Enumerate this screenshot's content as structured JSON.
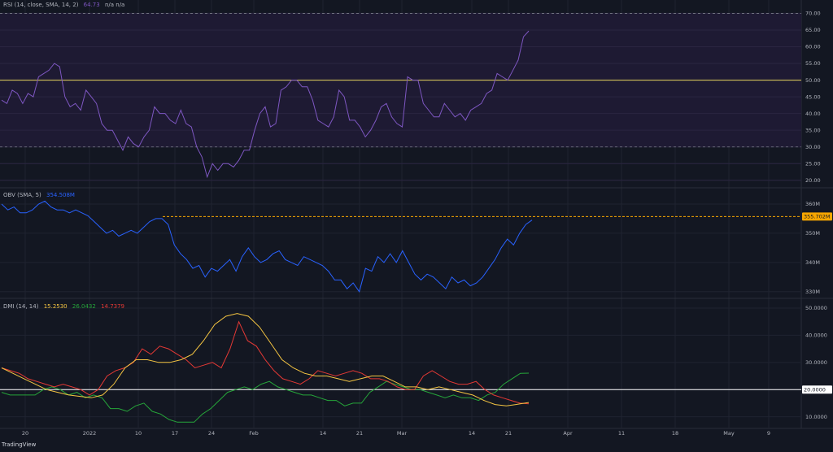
{
  "colors": {
    "background": "#131722",
    "grid": "#1f2330",
    "axis_text": "#b2b5be",
    "rsi_line": "#7e57c2",
    "rsi_band": "#1e1a33",
    "rsi_mid": "#e5d35b",
    "obv_line": "#2962ff",
    "obv_level": "#f7a600",
    "dmi_plus": "#26a63a",
    "dmi_minus": "#e53935",
    "dmi_adx": "#f5c542",
    "dmi_level": "#ffffff"
  },
  "panels": {
    "rsi": {
      "label": "RSI (14, close, SMA, 14, 2)",
      "value": "64.73",
      "extra": "n/a n/a"
    },
    "obv": {
      "label": "OBV (SMA, 5)",
      "value": "354.508M"
    },
    "dmi": {
      "label": "DMI (14, 14)",
      "adx_value": "15.2530",
      "plus_value": "26.0432",
      "minus_value": "14.7379"
    }
  },
  "brand": "TradingView",
  "chart_data": [
    {
      "type": "line",
      "title": "RSI (14, close, SMA, 14, 2)",
      "ylim": [
        18,
        74
      ],
      "yticks": [
        "70.00",
        "65.00",
        "60.00",
        "55.00",
        "50.00",
        "45.00",
        "40.00",
        "35.00",
        "30.00",
        "25.00",
        "20.00"
      ],
      "levels": [
        70,
        50,
        30
      ],
      "series": [
        {
          "values": [
            44,
            43,
            47,
            46,
            43,
            46,
            45,
            51,
            52,
            53,
            55,
            54,
            45,
            42,
            43,
            41,
            47,
            45,
            43,
            37,
            35,
            35,
            32,
            29,
            33,
            31,
            30,
            33,
            35,
            42,
            40,
            40,
            38,
            37,
            41,
            37,
            36,
            30,
            27,
            21,
            25,
            23,
            25,
            25,
            24,
            26,
            29,
            29,
            35,
            40,
            42,
            36,
            37,
            47,
            48,
            50,
            50,
            48,
            48,
            44,
            38,
            37,
            36,
            39,
            47,
            45,
            38,
            38,
            36,
            33,
            35,
            38,
            42,
            43,
            39,
            37,
            36,
            51,
            50,
            50,
            43,
            41,
            39,
            39,
            43,
            41,
            39,
            40,
            38,
            41,
            42,
            43,
            46,
            47,
            52,
            51,
            50,
            53,
            56,
            63,
            64.73
          ]
        }
      ]
    },
    {
      "type": "line",
      "title": "OBV (SMA, 5)",
      "ylim": [
        328,
        365
      ],
      "yticks": [
        "360M",
        "350M",
        "340M",
        "330M"
      ],
      "level": "355.702M",
      "series": [
        {
          "values": [
            360,
            358,
            359,
            357,
            357,
            358,
            360,
            361,
            359,
            358,
            358,
            357,
            358,
            357,
            356,
            354,
            352,
            350,
            351,
            349,
            350,
            351,
            350,
            352,
            354,
            355,
            355,
            353,
            346,
            343,
            341,
            338,
            339,
            335,
            338,
            337,
            339,
            341,
            337,
            342,
            345,
            342,
            340,
            341,
            343,
            344,
            341,
            340,
            339,
            342,
            341,
            340,
            339,
            337,
            334,
            334,
            331,
            333,
            330,
            338,
            337,
            342,
            340,
            343,
            340,
            344,
            340,
            336,
            334,
            336,
            335,
            333,
            331,
            335,
            333,
            334,
            332,
            333,
            335,
            338,
            341,
            345,
            348,
            346,
            350,
            353,
            354.508
          ]
        }
      ]
    },
    {
      "type": "line",
      "title": "DMI (14, 14)",
      "ylim": [
        6,
        53
      ],
      "yticks": [
        "50.0000",
        "40.0000",
        "30.0000",
        "20.0000",
        "10.0000"
      ],
      "level": "20.0000",
      "series": [
        {
          "color": "#26a63a",
          "values": [
            19,
            18,
            18,
            18,
            18,
            20,
            21,
            20,
            18,
            19,
            17,
            18,
            17,
            13,
            13,
            12,
            14,
            15,
            12,
            11,
            9,
            8,
            8,
            8,
            11,
            13,
            16,
            19,
            20,
            21,
            20,
            22,
            23,
            21,
            20,
            19,
            18,
            18,
            17,
            16,
            16,
            14,
            15,
            15,
            19,
            21,
            23,
            22,
            21,
            20,
            20,
            19,
            18,
            17,
            18,
            17,
            17,
            16,
            18,
            19,
            22,
            24,
            26,
            26.0432
          ]
        },
        {
          "color": "#e53935",
          "values": [
            28,
            27,
            26,
            24,
            23,
            22,
            21,
            22,
            21,
            20,
            18,
            20,
            25,
            27,
            28,
            30,
            35,
            33,
            36,
            35,
            33,
            31,
            28,
            29,
            30,
            28,
            35,
            45,
            38,
            36,
            31,
            27,
            24,
            23,
            22,
            24,
            27,
            26,
            25,
            26,
            27,
            26,
            24,
            24,
            23,
            21,
            20,
            20,
            25,
            27,
            25,
            23,
            22,
            22,
            23,
            20,
            18,
            17,
            16,
            15,
            14.7379
          ]
        },
        {
          "color": "#f5c542",
          "values": [
            28,
            26,
            24,
            22,
            20,
            19,
            18,
            17.5,
            17,
            18,
            22,
            28,
            31,
            31,
            30,
            30,
            31,
            33,
            38,
            44,
            47,
            48,
            47,
            43,
            37,
            31,
            28,
            26,
            25,
            25,
            24,
            23,
            24,
            25,
            25,
            23,
            21,
            21,
            20,
            21,
            20,
            19,
            18,
            16,
            14.5,
            14,
            14.6,
            15.253
          ]
        }
      ]
    }
  ],
  "time_axis": [
    "20",
    "2022",
    "10",
    "17",
    "24",
    "Feb",
    "14",
    "21",
    "Mar",
    "14",
    "21",
    "Apr",
    "11",
    "18",
    "May",
    "9"
  ]
}
